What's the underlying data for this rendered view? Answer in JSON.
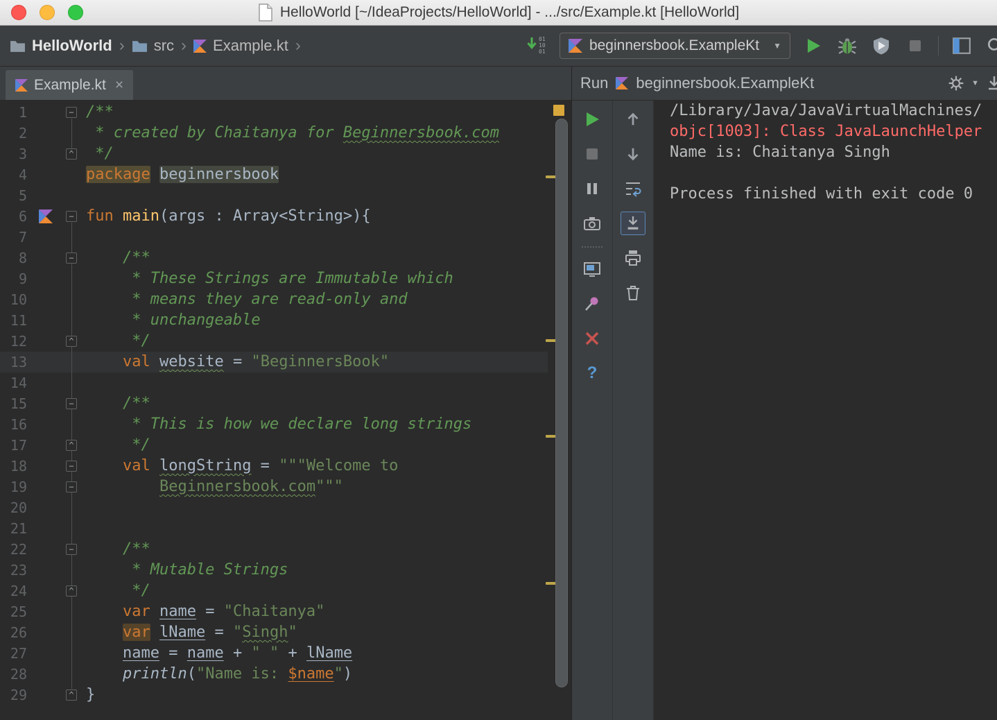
{
  "titlebar": {
    "title": "HelloWorld [~/IdeaProjects/HelloWorld] - .../src/Example.kt [HelloWorld]"
  },
  "toolbar": {
    "breadcrumbs": [
      {
        "label": "HelloWorld"
      },
      {
        "label": "src"
      },
      {
        "label": "Example.kt"
      }
    ],
    "run_config": "beginnersbook.ExampleKt"
  },
  "icons": {
    "chevron": "›",
    "dropdown": "▼",
    "close": "×",
    "help": "?",
    "fold_collapse": "−",
    "fold_end": "^"
  },
  "editor": {
    "tab_label": "Example.kt",
    "lines": [
      {
        "n": 1,
        "fold": "start",
        "t": [
          [
            "/**",
            "cm"
          ]
        ]
      },
      {
        "n": 2,
        "fold": "",
        "t": [
          [
            " * created by Chaitanya for ",
            "cm"
          ],
          [
            "Beginnersbook.com",
            "cm w"
          ]
        ]
      },
      {
        "n": 3,
        "fold": "end",
        "t": [
          [
            " */",
            "cm"
          ]
        ]
      },
      {
        "n": 4,
        "fold": "",
        "t": [
          [
            "package",
            "kw hl1"
          ],
          [
            " "
          ],
          [
            "beginnersbook",
            "hl2"
          ]
        ]
      },
      {
        "n": 5,
        "fold": "",
        "t": []
      },
      {
        "n": 6,
        "fold": "start",
        "icon": "kotlin",
        "t": [
          [
            "fun",
            "kw"
          ],
          [
            " "
          ],
          [
            "main",
            "fn"
          ],
          [
            "(args : Array<String>){"
          ]
        ]
      },
      {
        "n": 7,
        "fold": "",
        "t": []
      },
      {
        "n": 8,
        "fold": "start",
        "t": [
          [
            "    "
          ],
          [
            "/**",
            "cm"
          ]
        ]
      },
      {
        "n": 9,
        "fold": "",
        "t": [
          [
            "     * These Strings are Immutable which",
            "cm"
          ]
        ]
      },
      {
        "n": 10,
        "fold": "",
        "t": [
          [
            "     * means they are read-only and",
            "cm"
          ]
        ]
      },
      {
        "n": 11,
        "fold": "",
        "t": [
          [
            "     * unchangeable",
            "cm"
          ]
        ]
      },
      {
        "n": 12,
        "fold": "end",
        "t": [
          [
            "     */",
            "cm"
          ]
        ]
      },
      {
        "n": 13,
        "fold": "",
        "hl": "caret",
        "t": [
          [
            "    "
          ],
          [
            "val",
            "kw"
          ],
          [
            " "
          ],
          [
            "website",
            "w"
          ],
          [
            " = "
          ],
          [
            "\"BeginnersBook\"",
            "str"
          ]
        ]
      },
      {
        "n": 14,
        "fold": "",
        "t": []
      },
      {
        "n": 15,
        "fold": "start",
        "t": [
          [
            "    "
          ],
          [
            "/**",
            "cm"
          ]
        ]
      },
      {
        "n": 16,
        "fold": "",
        "t": [
          [
            "     * This is how we declare long strings",
            "cm"
          ]
        ]
      },
      {
        "n": 17,
        "fold": "end",
        "t": [
          [
            "     */",
            "cm"
          ]
        ]
      },
      {
        "n": 18,
        "fold": "start",
        "t": [
          [
            "    "
          ],
          [
            "val",
            "kw"
          ],
          [
            " "
          ],
          [
            "longString",
            "w"
          ],
          [
            " = "
          ],
          [
            "\"\"\"Welcome to",
            "str"
          ]
        ]
      },
      {
        "n": 19,
        "fold": "start",
        "t": [
          [
            "        "
          ],
          [
            "Beginnersbook.com",
            "str w"
          ],
          [
            "\"\"\"",
            "str"
          ]
        ]
      },
      {
        "n": 20,
        "fold": "",
        "t": []
      },
      {
        "n": 21,
        "fold": "",
        "t": []
      },
      {
        "n": 22,
        "fold": "start",
        "t": [
          [
            "    "
          ],
          [
            "/**",
            "cm"
          ]
        ]
      },
      {
        "n": 23,
        "fold": "",
        "t": [
          [
            "     * Mutable Strings",
            "cm"
          ]
        ]
      },
      {
        "n": 24,
        "fold": "end",
        "t": [
          [
            "     */",
            "cm"
          ]
        ]
      },
      {
        "n": 25,
        "fold": "",
        "t": [
          [
            "    "
          ],
          [
            "var",
            "kw"
          ],
          [
            " "
          ],
          [
            "name",
            "u"
          ],
          [
            " = "
          ],
          [
            "\"Chaitanya\"",
            "str"
          ]
        ]
      },
      {
        "n": 26,
        "fold": "",
        "t": [
          [
            "    "
          ],
          [
            "var",
            "kw hl3"
          ],
          [
            " "
          ],
          [
            "lName",
            "u"
          ],
          [
            " = "
          ],
          [
            "\"",
            "str"
          ],
          [
            "Singh",
            "str w"
          ],
          [
            "\"",
            "str"
          ]
        ]
      },
      {
        "n": 27,
        "fold": "",
        "t": [
          [
            "    "
          ],
          [
            "name",
            "u"
          ],
          [
            " = "
          ],
          [
            "name",
            "u"
          ],
          [
            " + "
          ],
          [
            "\" \"",
            "str"
          ],
          [
            " + "
          ],
          [
            "lName",
            "u"
          ]
        ]
      },
      {
        "n": 28,
        "fold": "",
        "t": [
          [
            "    "
          ],
          [
            "println",
            "i"
          ],
          [
            "("
          ],
          [
            "\"Name is: ",
            "str"
          ],
          [
            "$name",
            "tpl u"
          ],
          [
            "\"",
            "str"
          ],
          [
            ")"
          ]
        ]
      },
      {
        "n": 29,
        "fold": "end",
        "t": [
          [
            "}"
          ]
        ]
      }
    ]
  },
  "run_panel": {
    "label": "Run",
    "config": "beginnersbook.ExampleKt",
    "console": [
      {
        "text": "/Library/Java/JavaVirtualMachines/",
        "type": "out"
      },
      {
        "text": "objc[1003]: Class JavaLaunchHelper",
        "type": "err"
      },
      {
        "text": "Name is: Chaitanya Singh",
        "type": "out"
      },
      {
        "text": "",
        "type": "out"
      },
      {
        "text": "Process finished with exit code 0",
        "type": "out"
      }
    ]
  },
  "colors": {
    "accent_green": "#4db151",
    "error_red": "#ff6b68",
    "warning_yellow": "#d9a83c",
    "editor_bg": "#2b2b2b",
    "panel_bg": "#3c3f41"
  }
}
